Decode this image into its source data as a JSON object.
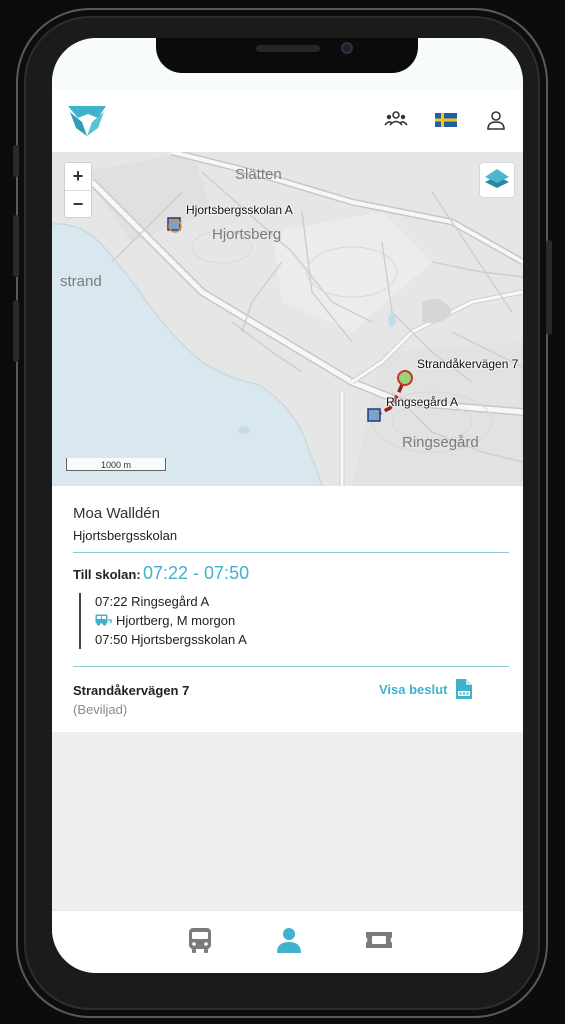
{
  "header": {
    "logo_icon": "brand-logo-icon",
    "group_icon": "people-group-icon",
    "flag_icon": "swedish-flag-icon",
    "profile_icon": "user-profile-icon"
  },
  "map": {
    "zoom_in": "+",
    "zoom_out": "−",
    "layers_icon": "layers-icon",
    "labels": {
      "place_slatten": "Slätten",
      "place_hjortsberg": "Hjortsberg",
      "place_strand": "strand",
      "place_ringsegard": "Ringsegård",
      "stop_school": "Hjortsbergsskolan A",
      "stop_home": "Strandåkervägen 7",
      "stop_pickup": "Ringsegård A"
    },
    "scale_label": "1000 m"
  },
  "student": {
    "name": "Moa Walldén",
    "school": "Hjortsbergsskolan"
  },
  "trip": {
    "label": "Till skolan:",
    "time_range": "07:22 - 07:50",
    "departure": "07:22 Ringsegård A",
    "route": "Hjortberg, M morgon",
    "arrival": "07:50 Hjortsbergsskolan A"
  },
  "decision": {
    "address": "Strandåkervägen 7",
    "status": "(Beviljad)",
    "link_label": "Visa beslut",
    "pdf_icon": "pdf-document-icon"
  },
  "colors": {
    "accent": "#3fb2cc",
    "route": "#9b1c1c"
  },
  "bottom_nav": {
    "items": [
      {
        "icon": "bus-icon",
        "active": false
      },
      {
        "icon": "person-icon",
        "active": true
      },
      {
        "icon": "ticket-icon",
        "active": false
      }
    ]
  }
}
